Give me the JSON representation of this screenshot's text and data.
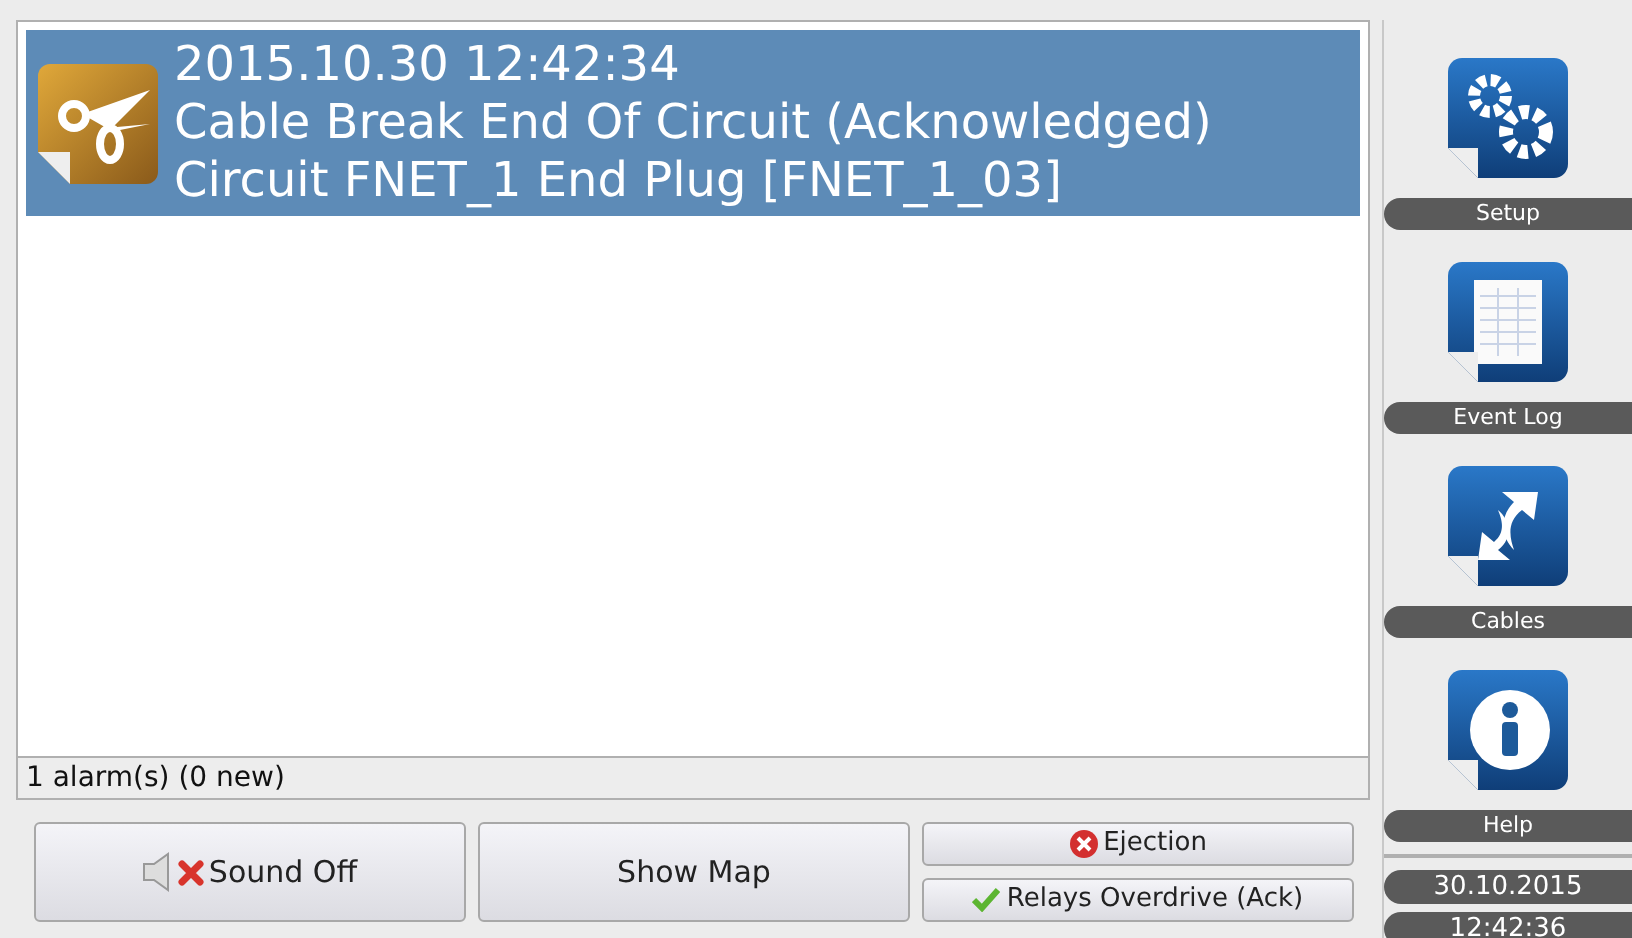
{
  "alarms": [
    {
      "timestamp": "2015.10.30 12:42:34",
      "title": "Cable Break End Of Circuit (Acknowledged)",
      "detail": "Circuit FNET_1 End Plug [FNET_1_03]",
      "selected": true
    }
  ],
  "status_bar": "1 alarm(s) (0 new)",
  "buttons": [
    {
      "kind": "sound",
      "label": "Sound Off"
    },
    {
      "kind": "plain",
      "label": "Show Map"
    }
  ],
  "small_buttons": [
    {
      "kind": "error",
      "label": "Ejection"
    },
    {
      "kind": "check",
      "label": "Relays Overdrive (Ack)"
    }
  ],
  "sidebar": {
    "items": [
      {
        "kind": "gears",
        "label": "Setup"
      },
      {
        "kind": "log",
        "label": "Event Log"
      },
      {
        "kind": "cables",
        "label": "Cables"
      },
      {
        "kind": "info",
        "label": "Help"
      }
    ],
    "date": "30.10.2015",
    "time": "12:42:36"
  }
}
